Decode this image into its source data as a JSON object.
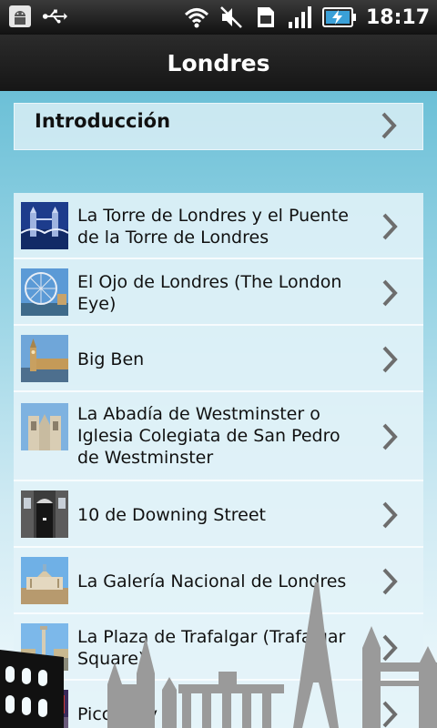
{
  "status_bar": {
    "time": "18:17",
    "left_icons": [
      "android-debug-icon",
      "usb-icon"
    ],
    "right_icons": [
      "wifi-icon",
      "mute-icon",
      "sim-icon",
      "signal-icon",
      "battery-charging-icon"
    ]
  },
  "title_bar": {
    "title": "Londres"
  },
  "intro": {
    "label": "Introducción"
  },
  "places": [
    {
      "label": "La Torre de Londres y el Puente de la Torre de Londres"
    },
    {
      "label": "El Ojo de Londres (The London Eye)"
    },
    {
      "label": "Big Ben"
    },
    {
      "label": "La Abadía de Westminster o Iglesia Colegiata de San Pedro de Westminster"
    },
    {
      "label": "10 de Downing Street"
    },
    {
      "label": "La Galería Nacional de Londres"
    },
    {
      "label": "La Plaza de Trafalgar (Trafalgar Square)"
    },
    {
      "label": "Piccadilly"
    }
  ],
  "colors": {
    "title_bar": "#1f1f1f",
    "content_top": "#6cc0d7",
    "content_bottom": "#f2fafd",
    "chevron": "#6d6d6d",
    "skyline": "#9a9a9a"
  }
}
